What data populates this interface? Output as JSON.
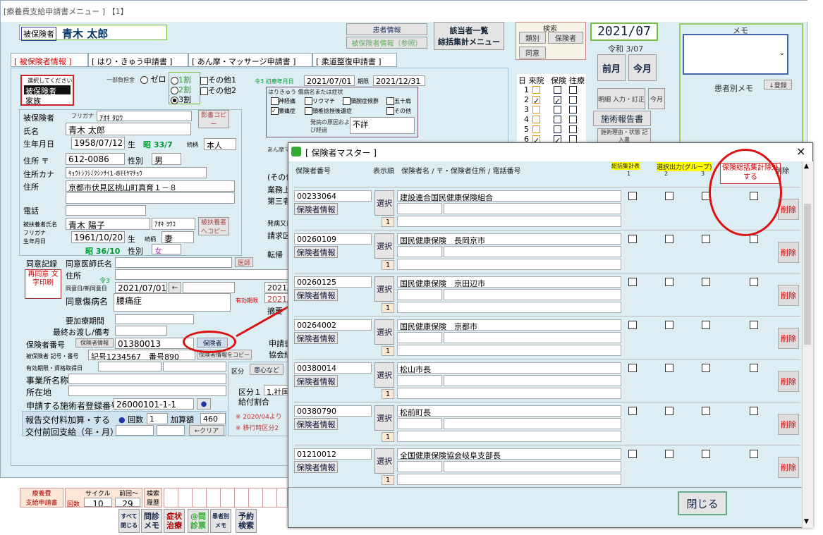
{
  "window_title": "[療養費支給申請書メニュー ] 【1】",
  "insured_label": "被保険者",
  "insured_name": "青木 太郎",
  "patient_info": "患者情報",
  "insured_info_ref": "被保険者情報（参照）",
  "list_link_1": "該当者一覧",
  "list_link_2": "綜括集計メニュー",
  "kensaku": "検索",
  "kensaku_type": "類別",
  "kensaku_ins": "保険者",
  "doui": "同意",
  "year_month": "2021/07",
  "reiwa": "令和 3/07",
  "prev_month": "前月",
  "this_month": "今月",
  "memo_title": "メモ",
  "patient_memo": "患者別メモ",
  "register": "↓登録",
  "tabs": [
    "[ 被保険者情報 ]",
    "[ はり・きゅう申請書 ]",
    "[ あん摩・マッサージ申請書 ]",
    "[ 柔道整復申請書 ]"
  ],
  "select_hint": "選択してください",
  "option_insured": "被保険者",
  "option_family": "家族",
  "burden_label": "一部負担金",
  "radio_zero": "ゼロ",
  "radio_1": "1割",
  "radio_2": "2割",
  "radio_3": "3割",
  "other1": "その他1",
  "other2": "その他2",
  "shoken_date_label": "令3 初療年月日",
  "shoken_date": "2021/07/01",
  "period_label": "期限",
  "period_date": "2021/12/31",
  "hari_title": "はりきゅう 傷病名または症状",
  "hari_items": [
    "神経痛",
    "リウマチ",
    "頸腕症候群",
    "五十肩",
    "腰痛症",
    "頸椎捻挫後遺症",
    "その他"
  ],
  "onset_label": "発病の原因および経過",
  "onset_value": "不詳",
  "amma_label": "あん摩マッサ",
  "visit_header": "日 来院",
  "insurance_header": "保険",
  "ouryo_header": "往療",
  "visit_days": [
    "1",
    "2",
    "3",
    "4",
    "5",
    "6"
  ],
  "menu_btn_1": "明細 入力・訂正",
  "menu_btn_2": "今月",
  "menu_btn_3": "施術報告書",
  "menu_btn_4": "施術理由・状態 記入書",
  "furigana_label": "フリガナ",
  "furigana_value": "ｱｵｷ ﾀﾛｳ",
  "shadow_copy": "影書コピー",
  "name_label": "氏名",
  "name_value": "青木 太郎",
  "birth_label": "生年月日",
  "birth_value": "1958/07/12",
  "birth_suffix": "生",
  "birth_era": "昭 33/7",
  "relation_label": "続柄",
  "relation_value": "本人",
  "zip_label": "住所 〒",
  "zip_value": "612-0086",
  "sex_label": "性別",
  "sex_value": "男",
  "addr_kana_label": "住所カナ",
  "addr_kana_value": "ｷｮｳﾄｼﾌｼﾐｸｼﾝｻｲ1-8ﾓﾓﾔﾏﾁｮｳ",
  "addr_label": "住所",
  "addr_value": "京都市伏見区桃山町真育１－８",
  "tel_label": "電話",
  "dep_name_label": "被扶養者氏名",
  "dep_name_value": "青木 陽子",
  "dep_kana_value": "ｱｵｷ ﾖｳｺ",
  "dep_copy": "被扶養者へコピー",
  "dep_furigana_label": "フリガナ",
  "dep_birth_label": "生年月日",
  "dep_birth_value": "1961/10/20",
  "dep_relation_value": "妻",
  "dep_era": "昭 36/10",
  "dep_sex_value": "女",
  "consent_label": "同意記録",
  "consent_doc_label": "同意医師氏名",
  "doctor": "医師",
  "reprint_label": "再同意 文字印刷",
  "consent_addr": "住所",
  "consent_reiwa": "令3",
  "consent_date_label": "同意日/新同意日",
  "consent_date": "2021/07/01",
  "consent_arrow": "←",
  "consent_disease_label": "同意傷病名",
  "consent_disease": "腰痛症",
  "valid_period": "有効期限",
  "required_period": "要加療期間",
  "last_handover": "最終お渡し/備考",
  "insurer_no_label": "保険者番号",
  "insurer_info_btn": "保険者情報",
  "insurer_no": "01380013",
  "insurer_btn": "保険者",
  "code_label": "被保険者 記号・番号",
  "code_value": "記号1234567　番号890",
  "code_copy": "保険者情報をコピー",
  "validity_label": "有効期限・資格取得日",
  "office_name_label": "事業所名称",
  "office_loc_label": "所在地",
  "reg_no_label": "申請する施術者登録番号",
  "reg_no": "26000101-1-1",
  "report_fee_label": "報告交付料加算・する",
  "times_label": "回数",
  "times_value": "1",
  "add_label": "加算額",
  "add_value": "460",
  "prev_pay_label": "交付前回支給（年・月）",
  "clear_btn": "←クリア",
  "kubun_label": "区分",
  "kubun_center": "患心など",
  "kubun1_label": "区分１",
  "kubun1_value": "1.社国",
  "benefit_label": "給付割合",
  "note_1": "※ 2020/04より",
  "note_2": "※ 移行時区分2",
  "mid_labels": [
    "(その他",
    "業務上",
    "第三者",
    "発病又は",
    "請求区",
    "転帰"
  ],
  "long_label": "長期",
  "period2_label": "期限",
  "period2_date": "2021/",
  "period3_date": "2021/",
  "summary_label": "摘要",
  "apply_label": "申請書",
  "assoc_label": "協会組",
  "bottom_tags": {
    "ryoyohi": "療養費",
    "shikyu": "支給申請書",
    "cycle": "サイクル",
    "prev": "前回～",
    "kaisu": "回数",
    "cycle_val": "10",
    "prev_val": "29",
    "kensaku": "検索",
    "rireki": "履歴"
  },
  "bottom_buttons": [
    "すべて 閉じる",
    "問診 メモ",
    "症状 治療",
    "@問 診票",
    "患者別 メモ",
    "予約 検索"
  ],
  "dialog": {
    "title": "[ 保険者マスター ]",
    "close": "×",
    "col_insurer_no": "保険者番号",
    "col_order": "表示順",
    "col_name": "保険者名 / 〒・保険者住所 / 電話番号",
    "col_sum": "総括集計表",
    "col_select_output": "選択出力(グループ)",
    "col_g1": "1",
    "col_g2": "2",
    "col_g3": "3",
    "col_exclude": "保険総括集計除外する",
    "col_delete": "削除",
    "select_btn": "選択",
    "info_btn": "保険者情報",
    "order_value": "1",
    "delete_btn": "削除",
    "rows": [
      {
        "no": "00233064",
        "name": "建設連合国民健康保険組合"
      },
      {
        "no": "00260109",
        "name": "国民健康保険　長岡京市"
      },
      {
        "no": "00260125",
        "name": "国民健康保険　京田辺市"
      },
      {
        "no": "00264002",
        "name": "国民健康保険　京都市"
      },
      {
        "no": "00380014",
        "name": "松山市長"
      },
      {
        "no": "00380790",
        "name": "松前町長"
      },
      {
        "no": "01210012",
        "name": "全国健康保険協会岐阜支部長"
      }
    ],
    "close_btn": "閉じる"
  },
  "colors": {
    "annotation": "#dd1111",
    "panel": "#dcedf3",
    "green_border": "#77bb44"
  }
}
